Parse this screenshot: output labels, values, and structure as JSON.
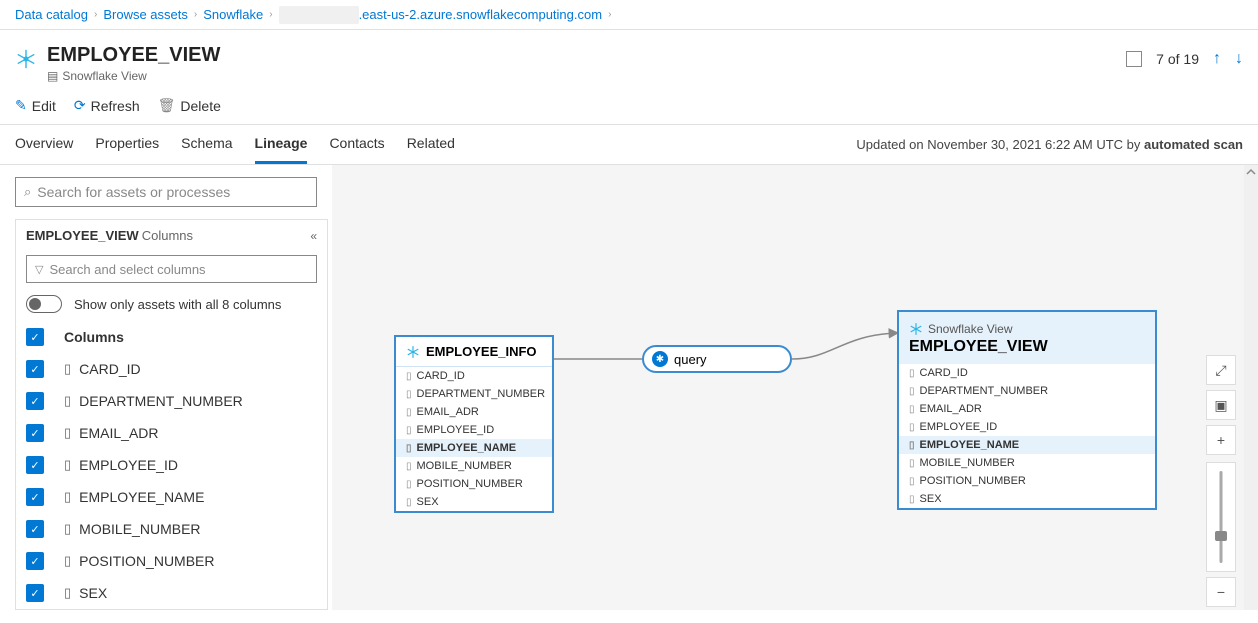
{
  "breadcrumb": {
    "items": [
      "Data catalog",
      "Browse assets",
      "Snowflake"
    ],
    "host": ".east-us-2.azure.snowflakecomputing.com"
  },
  "header": {
    "title": "EMPLOYEE_VIEW",
    "subtitle": "Snowflake View",
    "pager_text": "7 of 19"
  },
  "actions": {
    "edit": "Edit",
    "refresh": "Refresh",
    "delete": "Delete"
  },
  "tabs": [
    "Overview",
    "Properties",
    "Schema",
    "Lineage",
    "Contacts",
    "Related"
  ],
  "active_tab": "Lineage",
  "updated": {
    "prefix": "Updated on November 30, 2021 6:22 AM UTC by ",
    "by": "automated scan"
  },
  "search": {
    "placeholder": "Search for assets or processes"
  },
  "panel": {
    "title": "EMPLOYEE_VIEW",
    "suffix": "Columns",
    "search_placeholder": "Search and select columns",
    "toggle_label": "Show only assets with all 8 columns",
    "header_label": "Columns",
    "columns": [
      "CARD_ID",
      "DEPARTMENT_NUMBER",
      "EMAIL_ADR",
      "EMPLOYEE_ID",
      "EMPLOYEE_NAME",
      "MOBILE_NUMBER",
      "POSITION_NUMBER",
      "SEX"
    ]
  },
  "canvas": {
    "node1": {
      "title": "EMPLOYEE_INFO",
      "columns": [
        "CARD_ID",
        "DEPARTMENT_NUMBER",
        "EMAIL_ADR",
        "EMPLOYEE_ID",
        "EMPLOYEE_NAME",
        "MOBILE_NUMBER",
        "POSITION_NUMBER",
        "SEX"
      ],
      "highlight": "EMPLOYEE_NAME"
    },
    "query": "query",
    "node2": {
      "type": "Snowflake View",
      "title": "EMPLOYEE_VIEW",
      "columns": [
        "CARD_ID",
        "DEPARTMENT_NUMBER",
        "EMAIL_ADR",
        "EMPLOYEE_ID",
        "EMPLOYEE_NAME",
        "MOBILE_NUMBER",
        "POSITION_NUMBER",
        "SEX"
      ],
      "highlight": "EMPLOYEE_NAME"
    }
  }
}
